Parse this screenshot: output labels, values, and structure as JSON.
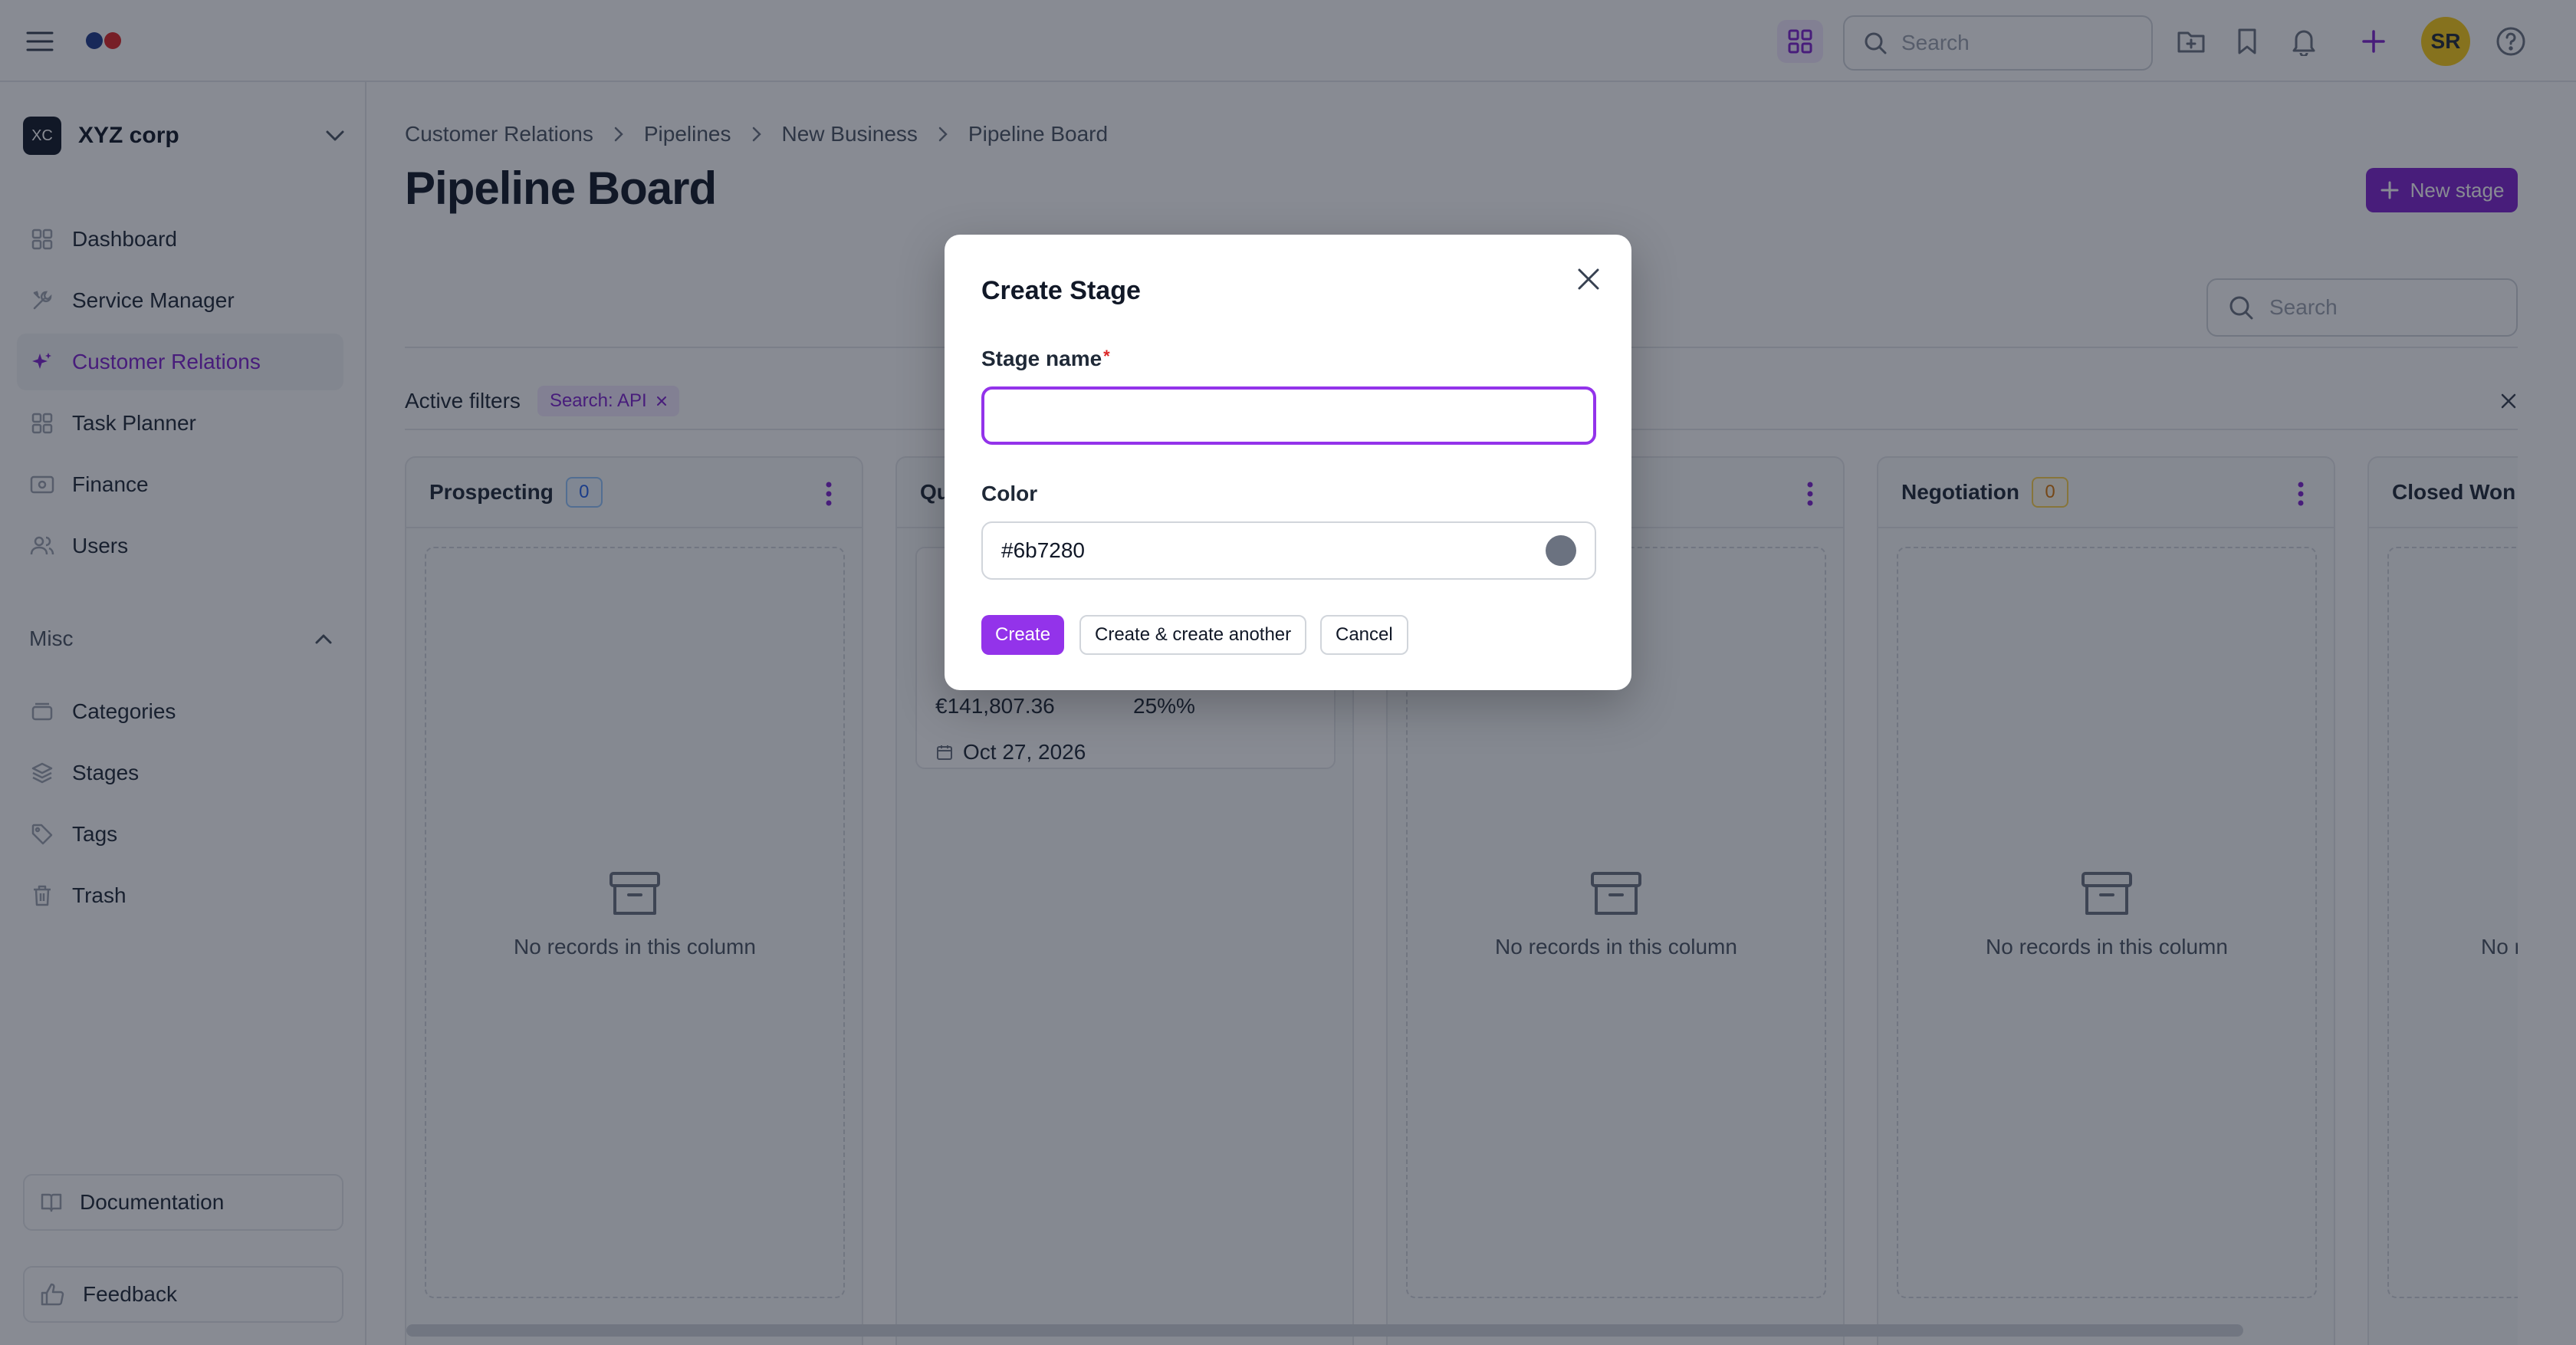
{
  "topbar": {
    "search_placeholder": "Search",
    "avatar_initials": "SR",
    "logo_colors": [
      "#1e3a8a",
      "#dc2626"
    ]
  },
  "sidebar": {
    "org_initials": "XC",
    "org_name": "XYZ corp",
    "items": [
      {
        "label": "Dashboard",
        "icon": "grid-icon"
      },
      {
        "label": "Service Manager",
        "icon": "tools-icon"
      },
      {
        "label": "Customer Relations",
        "icon": "sparkles-icon",
        "active": true
      },
      {
        "label": "Task Planner",
        "icon": "grid-icon"
      },
      {
        "label": "Finance",
        "icon": "banknote-icon"
      },
      {
        "label": "Users",
        "icon": "users-icon"
      }
    ],
    "misc_label": "Misc",
    "misc_items": [
      {
        "label": "Categories",
        "icon": "folder-icon"
      },
      {
        "label": "Stages",
        "icon": "layers-icon"
      },
      {
        "label": "Tags",
        "icon": "tag-icon"
      },
      {
        "label": "Trash",
        "icon": "trash-icon"
      }
    ],
    "documentation_label": "Documentation",
    "feedback_label": "Feedback"
  },
  "main": {
    "breadcrumb": [
      "Customer Relations",
      "Pipelines",
      "New Business",
      "Pipeline Board"
    ],
    "title": "Pipeline Board",
    "new_stage_label": "New stage",
    "search_placeholder": "Search",
    "active_filters_label": "Active filters",
    "filter_chip": "Search: API"
  },
  "board": {
    "empty_text": "No records in this column",
    "columns": [
      {
        "title": "Prospecting",
        "count": "0",
        "count_color": "#2563eb"
      },
      {
        "title": "Qu",
        "count": "",
        "count_color": "#2563eb"
      },
      {
        "title": "",
        "count": "",
        "count_color": "#2563eb"
      },
      {
        "title": "Negotiation",
        "count": "0",
        "count_color": "#d97706"
      },
      {
        "title": "Closed Won",
        "count": "",
        "count_color": "#16a34a"
      }
    ],
    "card": {
      "value": "€141,807.36",
      "probability": "25%%",
      "date": "Oct 27, 2026"
    },
    "partial_empty_text": "No r"
  },
  "modal": {
    "title": "Create Stage",
    "stage_name_label": "Stage name",
    "required_mark": "*",
    "stage_name_value": "",
    "color_label": "Color",
    "color_value": "#6b7280",
    "create_label": "Create",
    "create_another_label": "Create & create another",
    "cancel_label": "Cancel"
  },
  "colors": {
    "accent": "#7e22ce",
    "accent_light": "#f3e8ff",
    "overlay": "rgba(17,24,39,0.5)"
  }
}
